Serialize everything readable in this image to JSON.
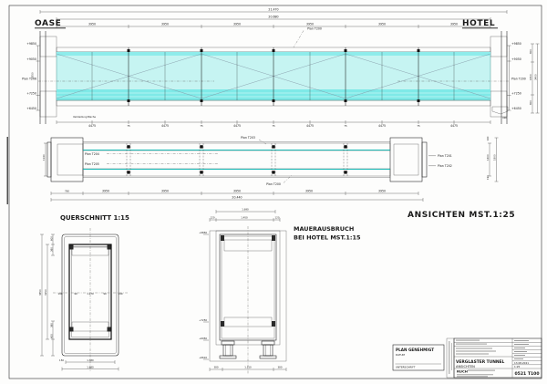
{
  "headers": {
    "oase": "OASE",
    "hotel": "HOTEL",
    "ansichten": "ANSICHTEN MST.1:25",
    "querschnitt": "QUERSCHNITT 1:15",
    "mauer_line1": "MAUERAUSBRUCH",
    "mauer_line2": "BEI HOTEL MST.1:15"
  },
  "elevation": {
    "overall_dim": "21.470",
    "inner_dim": "20.680",
    "segments": [
      "3950",
      "3950",
      "3950",
      "3950",
      "3950",
      "3950"
    ],
    "plan_ref_top": "Plan T200",
    "left_marks": [
      "+9850",
      "+9050",
      "Plan T206",
      "+7250",
      "+6450"
    ],
    "right_marks": [
      "+9850",
      "+9050",
      "Plan T200",
      "+7250",
      "+6450"
    ],
    "left_height": "2550",
    "right_heights": [
      "800",
      "1800",
      "800",
      "3400"
    ],
    "bottom_segments": [
      "4475",
      "4475",
      "4475",
      "4475",
      "4475",
      "4475"
    ],
    "bottom_sep": "75",
    "note": "Verkleidung Bleche",
    "bracket_dim": "490"
  },
  "plan": {
    "ref_top": "Plan T203",
    "ref_bottom": "Plan T200",
    "left_refs": [
      "Plan T204",
      "Plan T205"
    ],
    "right_refs": [
      "Plan T201",
      "Plan T202"
    ],
    "left_width": "1140",
    "right_widths": [
      "190",
      "1400",
      "1800",
      "190"
    ],
    "bottom_segments": [
      "780",
      "3950",
      "3950",
      "3950",
      "3950",
      "3950"
    ],
    "overall_dim": "20.440"
  },
  "section": {
    "height_outer": "3650",
    "height_inner": "3150",
    "top_dims": [
      "600",
      "360"
    ],
    "bottom_dims": [
      "360",
      "600"
    ],
    "mid_dims": [
      "190",
      "90",
      "1.270",
      "90",
      "190"
    ],
    "width_left": "150",
    "width_inner": "1.380",
    "width_overall": "1.680"
  },
  "ausbruch": {
    "top_overall": "1.690",
    "top_dims": [
      "120",
      "1.450",
      "120"
    ],
    "marks": [
      "+9850",
      "+7250",
      "+6950",
      "+6610"
    ],
    "bottom_dims": [
      "380",
      "1.310",
      "380"
    ]
  },
  "titleblock": {
    "approve_title": "PLAN GENEHMIGT",
    "approve_date_label": "DATUM",
    "approve_sign_label": "UNTERSCHRIFT",
    "project_line1": "VERGLASTER TUNNEL",
    "project_line2": "ANSICHTEN",
    "firm": "RUCH",
    "date": "13.08.2021",
    "scale": "1:25",
    "sheet_no": "0521  T100"
  }
}
